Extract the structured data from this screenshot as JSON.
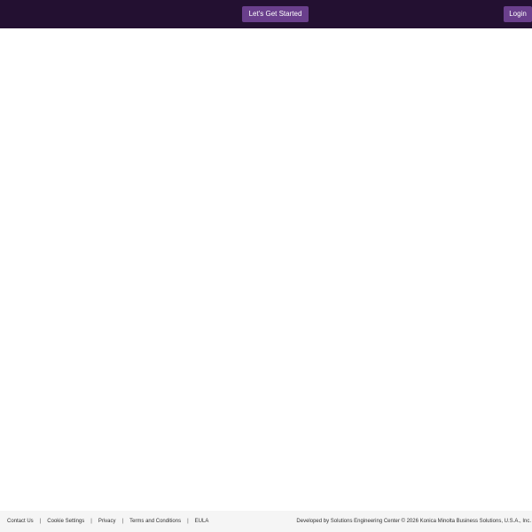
{
  "header": {
    "get_started_label": "Let's Get Started",
    "login_label": "Login",
    "colors": {
      "bar": "#231031",
      "button": "#6a3f8c"
    }
  },
  "footer": {
    "links": [
      "Contact Us",
      "Cookie Settings",
      "Privacy",
      "Terms and Conditions",
      "EULA"
    ],
    "separator": "|",
    "credit": "Developed by Solutions Engineering Center © 2026 Konica Minolta Business Solutions, U.S.A., Inc."
  }
}
